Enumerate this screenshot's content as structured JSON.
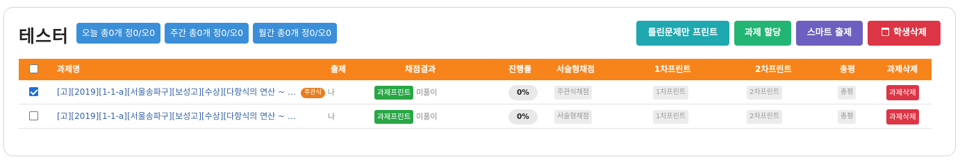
{
  "header": {
    "title": "테스터",
    "badges": [
      "오늘 총0개 정0/오0",
      "주간 총0개 정0/오0",
      "월간 총0개 정0/오0"
    ],
    "actions": {
      "print_wrong": "틀린문제만 프린트",
      "assign": "과제 할당",
      "smart": "스마트 출제",
      "delete_student": "학생삭제"
    }
  },
  "colors": {
    "header_bg": "#f7841a",
    "badge_blue": "#3b8fd9",
    "teal": "#1fa8b0",
    "green": "#22b573",
    "purple": "#6c5fc0",
    "red": "#dc3545"
  },
  "table": {
    "columns": {
      "name": "과제명",
      "setter": "출제",
      "grading": "채점결과",
      "progress": "진행률",
      "essay": "서술형채점",
      "print1": "1차프린트",
      "print2": "2차프린트",
      "review": "총평",
      "delete": "과제삭제"
    },
    "rows": [
      {
        "checked": true,
        "name": "[고][2019][1-1-a][서울송파구][보성고][수상][다항식의 연산 ~ …",
        "type_badge": "주관식",
        "setter": "나",
        "grading_btn": "과제프린트",
        "grading_status": "미풀이",
        "progress": "0%",
        "essay": "주관식채점",
        "print1": "1차프린트",
        "print2": "2차프린트",
        "review": "총평",
        "delete": "과제삭제"
      },
      {
        "checked": false,
        "name": "[고][2019][1-1-a][서울송파구][보성고][수상][다항식의 연산 ~ …",
        "type_badge": "",
        "setter": "나",
        "grading_btn": "과제프린트",
        "grading_status": "미풀이",
        "progress": "0%",
        "essay": "서술형채점",
        "print1": "1차프린트",
        "print2": "2차프린트",
        "review": "총평",
        "delete": "과제삭제"
      }
    ]
  }
}
